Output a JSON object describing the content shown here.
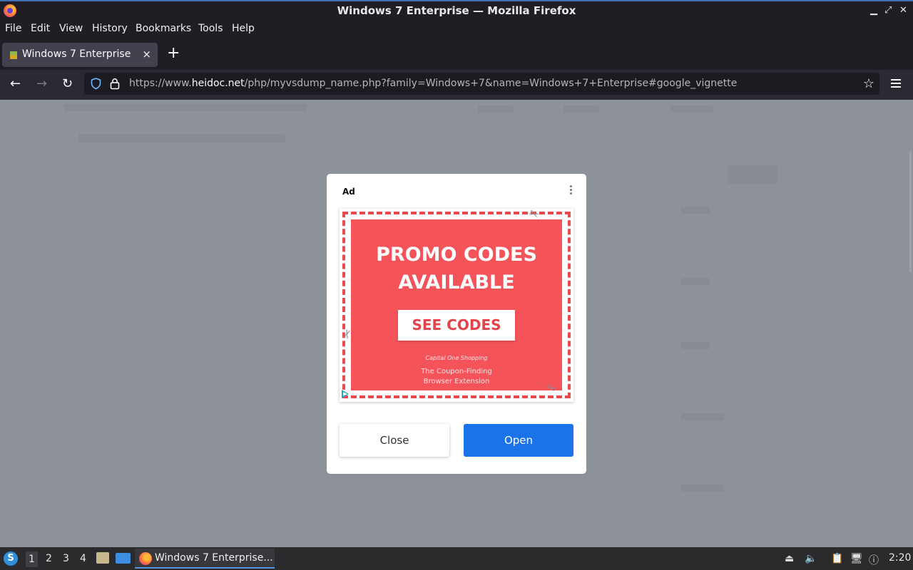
{
  "window": {
    "title": "Windows 7 Enterprise — Mozilla Firefox"
  },
  "menu": [
    "File",
    "Edit",
    "View",
    "History",
    "Bookmarks",
    "Tools",
    "Help"
  ],
  "tab": {
    "title": "Windows 7 Enterprise",
    "close": "×",
    "new_tab": "+"
  },
  "url": {
    "prefix": "https://www.",
    "domain": "heidoc.net",
    "path": "/php/myvsdump_name.php?family=Windows+7&name=Windows+7+Enterprise#google_vignette"
  },
  "ad": {
    "label": "Ad",
    "headline_line1": "PROMO CODES",
    "headline_line2": "AVAILABLE",
    "cta": "SEE CODES",
    "brand": "Capital One Shopping",
    "tagline_line1": "The Coupon-Finding",
    "tagline_line2": "Browser Extension",
    "close_label": "Close",
    "open_label": "Open"
  },
  "colors": {
    "coupon_red": "#f5535a",
    "open_blue": "#1a73e8",
    "firefox_dark": "#1f1e25"
  },
  "taskbar": {
    "workspaces": [
      "1",
      "2",
      "3",
      "4"
    ],
    "task_title": "Windows 7 Enterprise...",
    "clock": "2:20"
  }
}
